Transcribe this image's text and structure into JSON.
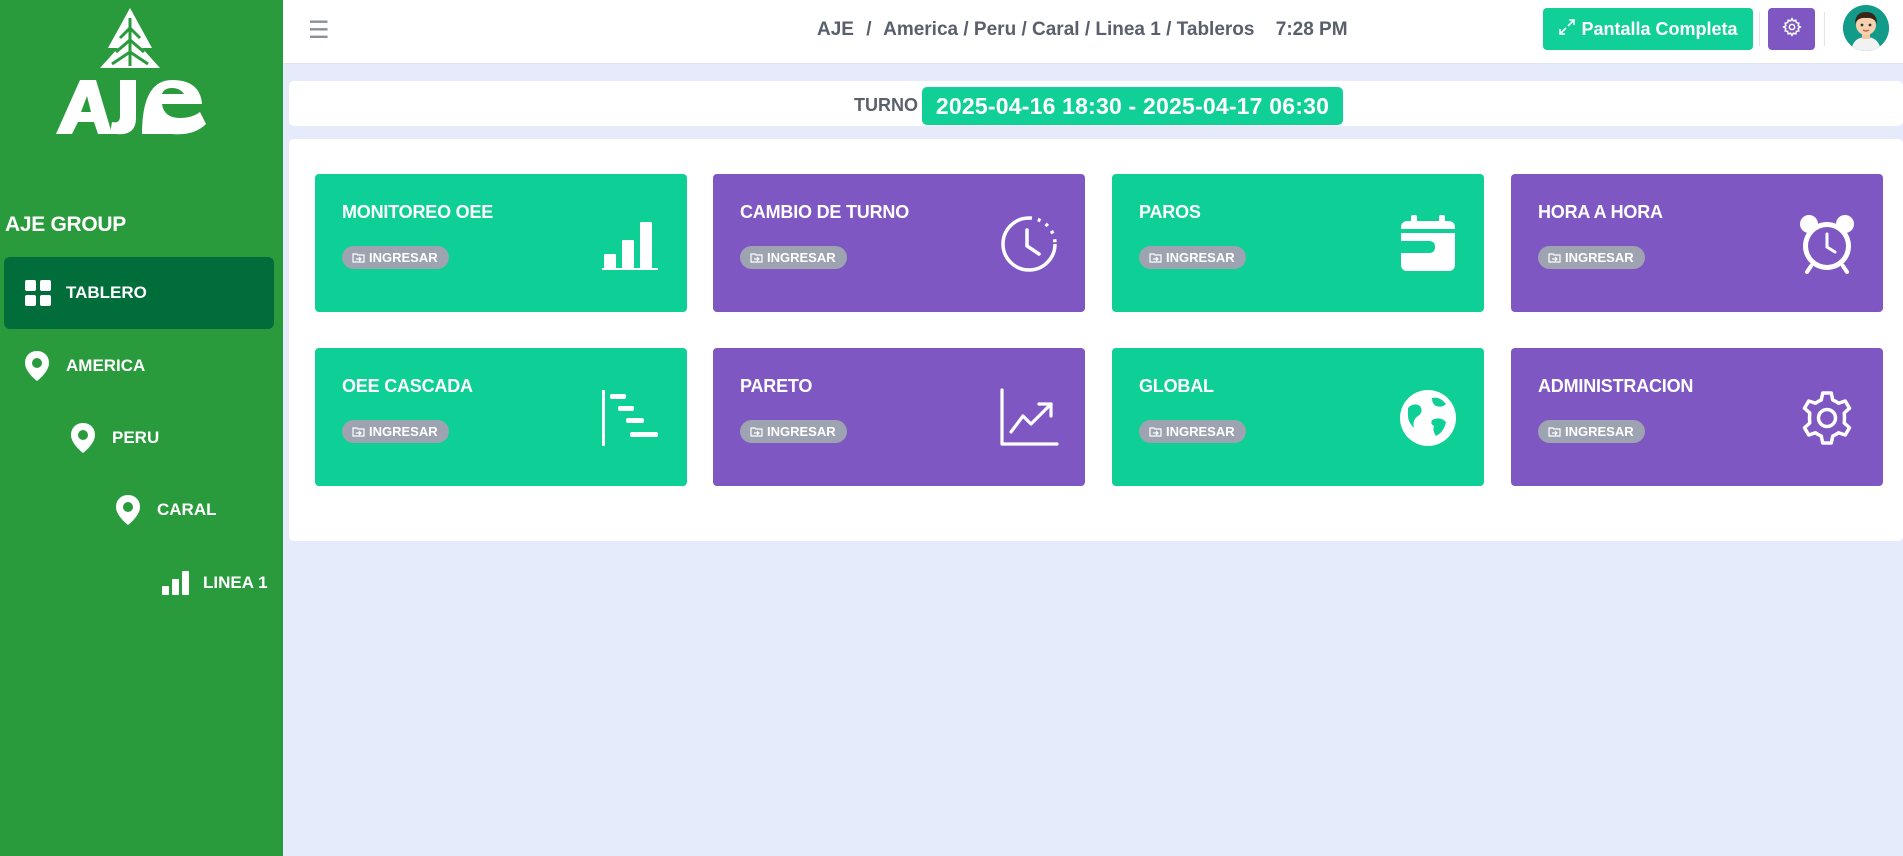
{
  "colors": {
    "sidebar_bg": "#2a9b3d",
    "sidebar_active": "#006d3a",
    "accent_green": "#10cf97",
    "accent_purple": "#7e57c2",
    "badge_gray": "#9da3b0",
    "page_bg": "#e6ebfc"
  },
  "sidebar": {
    "logo_text": "AJE",
    "group_title": "AJE GROUP",
    "items": [
      {
        "label": "TABLERO",
        "icon": "dashboard-grid-icon",
        "active": true
      },
      {
        "label": "AMERICA",
        "icon": "map-pin-icon"
      },
      {
        "label": "PERU",
        "icon": "map-pin-icon"
      },
      {
        "label": "CARAL",
        "icon": "map-pin-icon"
      },
      {
        "label": "LINEA 1",
        "icon": "bar-signal-icon"
      }
    ]
  },
  "topbar": {
    "menu_icon": "hamburger-icon",
    "breadcrumb": [
      "AJE",
      "America / Peru / Caral / Linea 1 / Tableros"
    ],
    "breadcrumb_separator": "/",
    "time": "7:28 PM",
    "fullscreen_label": "Pantalla Completa",
    "fullscreen_icon": "expand-arrows-icon",
    "settings_icon": "gear-icon",
    "avatar_icon": "user-avatar"
  },
  "turno": {
    "label": "TURNO",
    "value": "2025-04-16 18:30 - 2025-04-17 06:30"
  },
  "cards": [
    {
      "title": "MONITOREO OEE",
      "badge": "INGRESAR",
      "color": "green",
      "icon": "bar-chart-icon"
    },
    {
      "title": "CAMBIO DE TURNO",
      "badge": "INGRESAR",
      "color": "purple",
      "icon": "clock-icon"
    },
    {
      "title": "PAROS",
      "badge": "INGRESAR",
      "color": "green",
      "icon": "calendar-wallet-icon"
    },
    {
      "title": "HORA A HORA",
      "badge": "INGRESAR",
      "color": "purple",
      "icon": "alarm-clock-icon"
    },
    {
      "title": "OEE CASCADA",
      "badge": "INGRESAR",
      "color": "green",
      "icon": "waterfall-chart-icon"
    },
    {
      "title": "PARETO",
      "badge": "INGRESAR",
      "color": "purple",
      "icon": "trend-chart-icon"
    },
    {
      "title": "GLOBAL",
      "badge": "INGRESAR",
      "color": "green",
      "icon": "globe-icon"
    },
    {
      "title": "ADMINISTRACION",
      "badge": "INGRESAR",
      "color": "purple",
      "icon": "cog-icon"
    }
  ]
}
